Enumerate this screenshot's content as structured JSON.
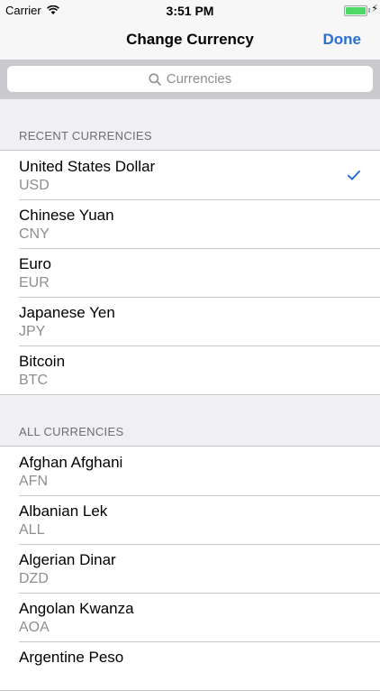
{
  "status_bar": {
    "carrier": "Carrier",
    "time": "3:51 PM",
    "battery_level": 1.0
  },
  "nav": {
    "title": "Change Currency",
    "done_label": "Done"
  },
  "search": {
    "placeholder": "Currencies"
  },
  "recent": {
    "header": "RECENT CURRENCIES",
    "items": [
      {
        "name": "United States Dollar",
        "code": "USD",
        "selected": true
      },
      {
        "name": "Chinese Yuan",
        "code": "CNY",
        "selected": false
      },
      {
        "name": "Euro",
        "code": "EUR",
        "selected": false
      },
      {
        "name": "Japanese Yen",
        "code": "JPY",
        "selected": false
      },
      {
        "name": "Bitcoin",
        "code": "BTC",
        "selected": false
      }
    ]
  },
  "all": {
    "header": "ALL CURRENCIES",
    "items": [
      {
        "name": "Afghan Afghani",
        "code": "AFN"
      },
      {
        "name": "Albanian Lek",
        "code": "ALL"
      },
      {
        "name": "Algerian Dinar",
        "code": "DZD"
      },
      {
        "name": "Angolan Kwanza",
        "code": "AOA"
      },
      {
        "name": "Argentine Peso",
        "code": ""
      }
    ]
  },
  "colors": {
    "accent": "#2a6fd1",
    "secondary_text": "#8e8e93",
    "battery": "#4cd964"
  }
}
